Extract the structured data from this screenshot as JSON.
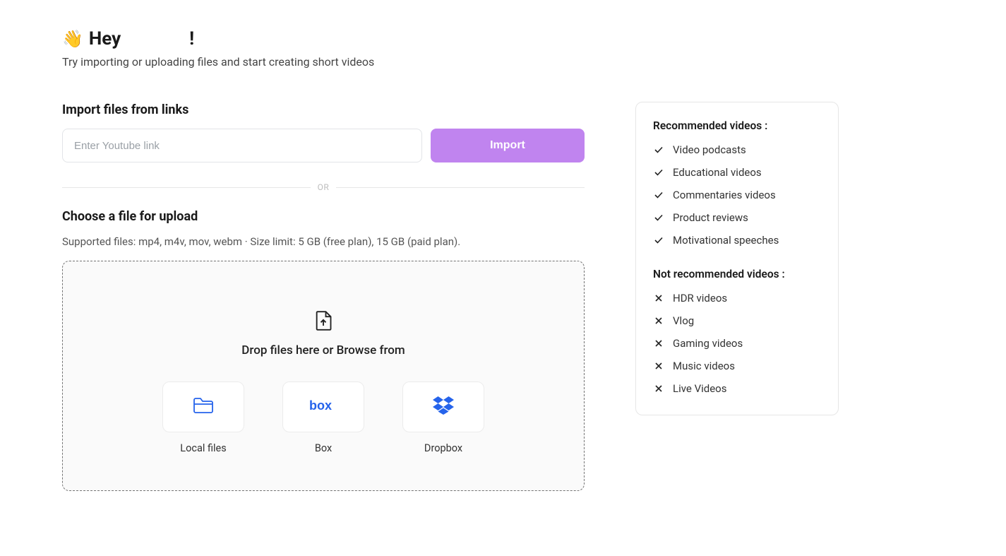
{
  "greeting": {
    "prefix": "Hey ",
    "name": "",
    "suffix": "!"
  },
  "subtitle": "Try importing or uploading files and start creating short videos",
  "import": {
    "title": "Import files from links",
    "placeholder": "Enter Youtube link",
    "button": "Import",
    "or": "OR"
  },
  "upload": {
    "title": "Choose a file for upload",
    "hint": "Supported files: mp4, m4v, mov, webm  ·  Size limit: 5 GB (free plan), 15 GB (paid plan).",
    "dropzone_text": "Drop files here or Browse from",
    "sources": {
      "local": "Local files",
      "box": "Box",
      "dropbox": "Dropbox"
    }
  },
  "sidebar": {
    "recommended_title": "Recommended videos :",
    "recommended": [
      "Video podcasts",
      "Educational videos",
      "Commentaries videos",
      "Product reviews",
      "Motivational speeches"
    ],
    "not_recommended_title": "Not recommended videos :",
    "not_recommended": [
      "HDR videos",
      "Vlog",
      "Gaming videos",
      "Music videos",
      "Live Videos"
    ]
  }
}
